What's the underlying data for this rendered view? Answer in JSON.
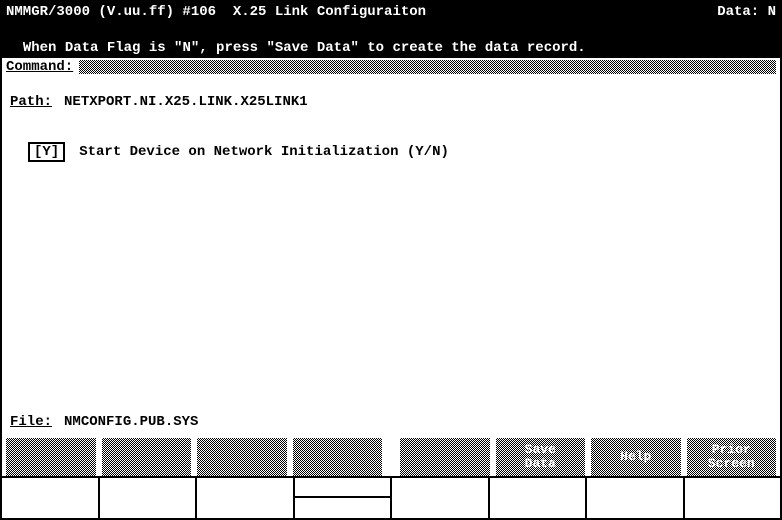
{
  "title_left": "NMMGR/3000 (V.uu.ff) #106  X.25 Link Configuraiton",
  "title_right": "Data: N",
  "message": "When Data Flag is \"N\", press \"Save Data\" to create the data record.",
  "command_label": "Command:",
  "path_label": "Path:",
  "path_value": "NETXPORT.NI.X25.LINK.X25LINK1",
  "field_value": "[Y]",
  "field_label": "Start Device on Network Initialization (Y/N)",
  "file_label": "File:",
  "file_value": "NMCONFIG.PUB.SYS",
  "fnkeys": [
    "",
    "",
    "",
    "",
    "",
    "Save\nData",
    "Help",
    "Prior\nScreen"
  ]
}
